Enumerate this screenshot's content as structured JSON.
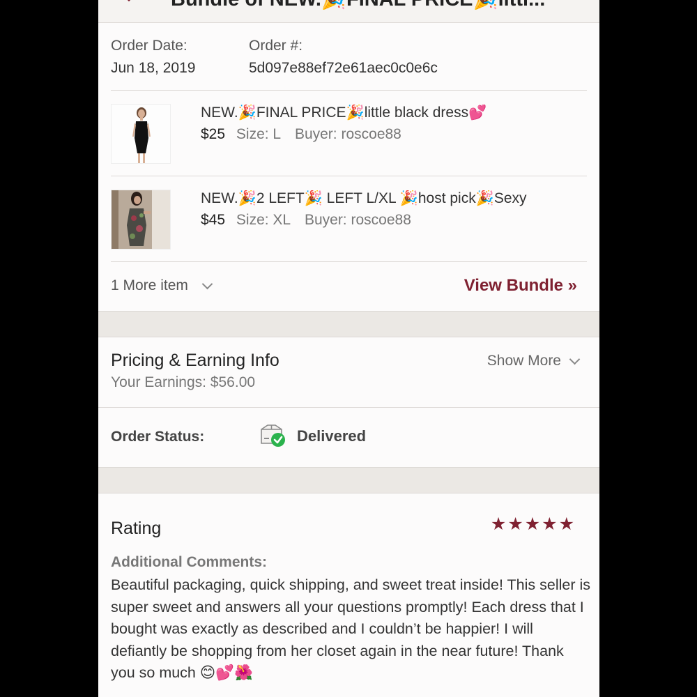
{
  "header": {
    "title": "Bundle of NEW.🎉FINAL PRICE🎉littl..."
  },
  "order": {
    "date_label": "Order Date:",
    "date_value": "Jun 18, 2019",
    "number_label": "Order #:",
    "number_value": "5d097e88ef72e61aec0c0e6c"
  },
  "items": [
    {
      "title": "NEW.🎉FINAL PRICE🎉little black dress💕",
      "price": "$25",
      "size": "Size: L",
      "buyer": "Buyer: roscoe88"
    },
    {
      "title": "NEW.🎉2 LEFT🎉 LEFT L/XL 🎉host pick🎉Sexy",
      "price": "$45",
      "size": "Size: XL",
      "buyer": "Buyer: roscoe88"
    }
  ],
  "bundle": {
    "more_items": "1 More item",
    "view_bundle": "View Bundle »"
  },
  "pricing": {
    "title": "Pricing & Earning Info",
    "earnings": "Your Earnings: $56.00",
    "show_more": "Show More"
  },
  "status": {
    "label": "Order Status:",
    "value": "Delivered",
    "icon": "delivered-box-icon",
    "check_color": "#2bb24c"
  },
  "rating": {
    "title": "Rating",
    "stars": 5,
    "max_stars": 5,
    "star_color": "#7f2131",
    "comments_label": "Additional Comments:",
    "comments": "Beautiful packaging, quick shipping, and sweet treat inside! This seller is super sweet and answers all your questions promptly! Each dress that I bought was exactly as described and I couldn’t be happier! I will defiantly be shopping from her closet again in the near future! Thank you so much 😊💕🌺"
  },
  "colors": {
    "accent": "#7f2131",
    "band": "#ebe8e4",
    "background": "#fcfbfb"
  }
}
